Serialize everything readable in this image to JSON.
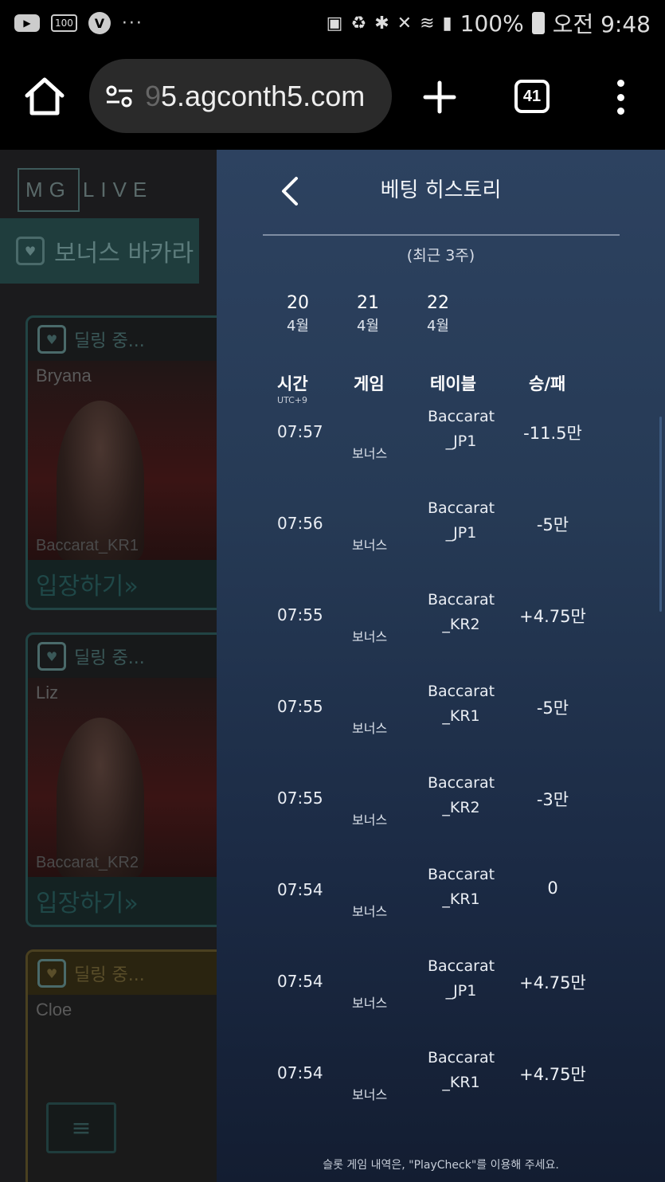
{
  "status_bar": {
    "left_icons": [
      "youtube-icon",
      "battery-100-icon",
      "v-app-icon",
      "more-icon"
    ],
    "battery_badge": "100",
    "v_label": "V",
    "dots": "···",
    "battery": "100%",
    "time": "오전 9:48"
  },
  "browser": {
    "url_faded": "9",
    "url": "5.agconth5.com",
    "tab_count": "41"
  },
  "background_app": {
    "logo_left": "MG",
    "logo_right": "LIVE",
    "game_tab": "보너스 바카라",
    "cards": [
      {
        "status": "딜링 중...",
        "dealer": "Bryana",
        "table": "Baccarat_KR1",
        "enter": "입장하기»"
      },
      {
        "status": "딜링 중...",
        "dealer": "Liz",
        "table": "Baccarat_KR2",
        "enter": "입장하기»"
      },
      {
        "status": "딜링 중...",
        "dealer": "Cloe",
        "table": "",
        "enter": ""
      }
    ]
  },
  "panel": {
    "title": "베팅 히스토리",
    "period": "(최근 3주)",
    "dates": [
      {
        "day": "20",
        "month": "4월"
      },
      {
        "day": "21",
        "month": "4월"
      },
      {
        "day": "22",
        "month": "4월"
      }
    ],
    "columns": {
      "time": "시간",
      "time_sub": "UTC+9",
      "game": "게임",
      "table": "테이블",
      "result": "승/패"
    },
    "rows": [
      {
        "time": "07:57",
        "game": "보너스",
        "table1": "Baccarat",
        "table2": "_JP1",
        "result": "-11.5만"
      },
      {
        "time": "07:56",
        "game": "보너스",
        "table1": "Baccarat",
        "table2": "_JP1",
        "result": "-5만"
      },
      {
        "time": "07:55",
        "game": "보너스",
        "table1": "Baccarat",
        "table2": "_KR2",
        "result": "+4.75만"
      },
      {
        "time": "07:55",
        "game": "보너스",
        "table1": "Baccarat",
        "table2": "_KR1",
        "result": "-5만"
      },
      {
        "time": "07:55",
        "game": "보너스",
        "table1": "Baccarat",
        "table2": "_KR2",
        "result": "-3만"
      },
      {
        "time": "07:54",
        "game": "보너스",
        "table1": "Baccarat",
        "table2": "_KR1",
        "result": "0"
      },
      {
        "time": "07:54",
        "game": "보너스",
        "table1": "Baccarat",
        "table2": "_JP1",
        "result": "+4.75만"
      },
      {
        "time": "07:54",
        "game": "보너스",
        "table1": "Baccarat",
        "table2": "_KR1",
        "result": "+4.75만"
      }
    ],
    "footer": "슬롯 게임 내역은, \"PlayCheck\"를 이용해 주세요."
  }
}
